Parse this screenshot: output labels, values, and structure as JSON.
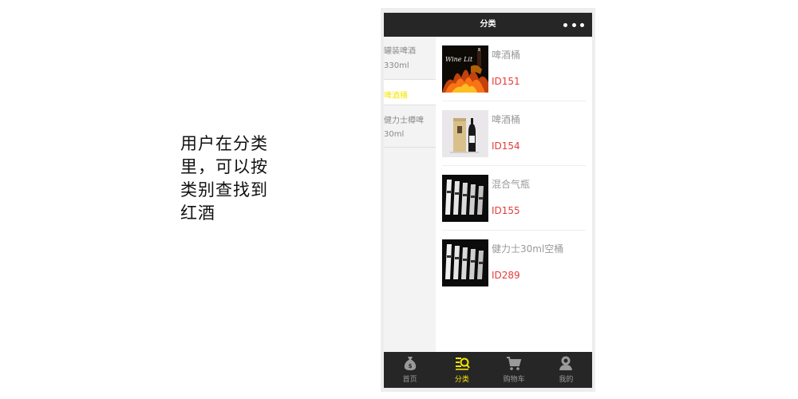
{
  "caption": {
    "lines": [
      "用户在分类",
      "里，可以按",
      "类别查找到",
      "红酒"
    ]
  },
  "header": {
    "title": "分类",
    "more_icon": "more-dots-icon"
  },
  "sidebar": {
    "items": [
      {
        "line1": "罐装啤酒",
        "line2": "330ml",
        "active": false
      },
      {
        "line1": "啤酒桶",
        "active": true
      },
      {
        "line1": "健力士樽啤",
        "line2": "30ml",
        "active": false
      }
    ],
    "active_color": "#f6e600"
  },
  "products": [
    {
      "name": "啤酒桶",
      "id": "ID151",
      "image": "wine-lit-fire-image"
    },
    {
      "name": "啤酒桶",
      "id": "ID154",
      "image": "wine-bottle-gift-box-image"
    },
    {
      "name": "混合气瓶",
      "id": "ID155",
      "image": "bottle-shelf-dark-image"
    },
    {
      "name": "健力士30ml空桶",
      "id": "ID289",
      "image": "bottle-shelf-dark-image"
    }
  ],
  "tabbar": {
    "tabs": [
      {
        "label": "首页",
        "icon": "money-bag-icon",
        "active": false
      },
      {
        "label": "分类",
        "icon": "category-list-search-icon",
        "active": true
      },
      {
        "label": "购物车",
        "icon": "cart-icon",
        "active": false
      },
      {
        "label": "我的",
        "icon": "user-icon",
        "active": false
      }
    ]
  },
  "colors": {
    "bar_bg": "#262626",
    "accent": "#f6e600",
    "price_id": "#e53b3b"
  }
}
